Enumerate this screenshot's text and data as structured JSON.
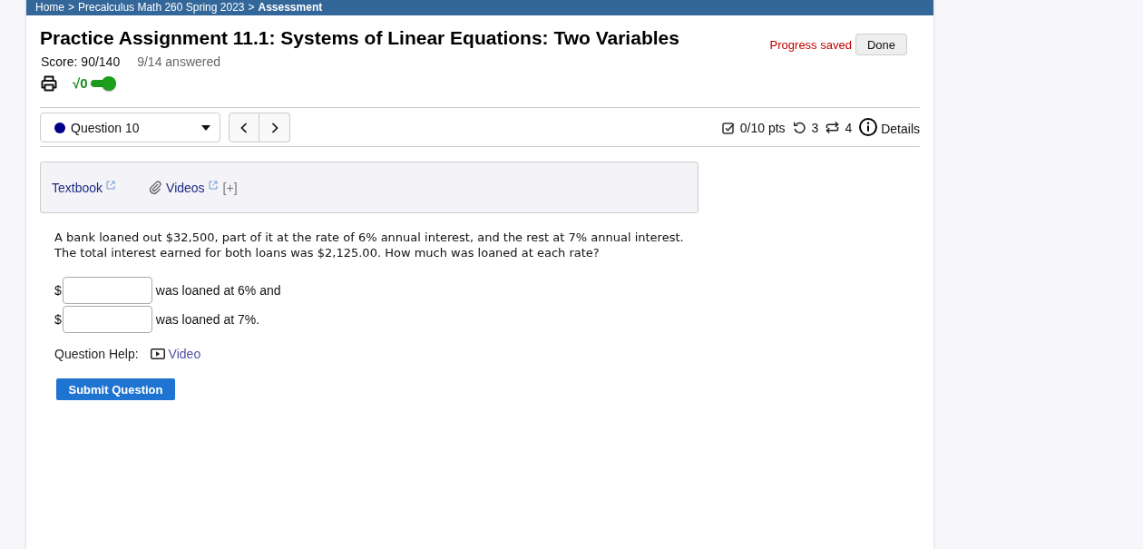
{
  "breadcrumb": [
    {
      "kind": "link",
      "label": "Home"
    },
    {
      "kind": "separator",
      "label": ">"
    },
    {
      "kind": "link",
      "label": "Precalculus Math 260 Spring 2023"
    },
    {
      "kind": "separator",
      "label": ">"
    },
    {
      "kind": "current",
      "label": "Assessment"
    }
  ],
  "header": {
    "title": "Practice Assignment 11.1: Systems of Linear Equations: Two Variables",
    "score": "Score: 90/140",
    "answered": "9/14 answered",
    "status": "Progress saved",
    "done_button": "Done",
    "math_toggle": {
      "label": "√0",
      "on": true
    }
  },
  "question_bar": {
    "selector": "Question 10",
    "points": "0/10 pts",
    "retries": "3",
    "attempts": "4",
    "details": "Details"
  },
  "help_box": {
    "links": [
      {
        "kind": "textbook",
        "label": "Textbook"
      },
      {
        "kind": "videos",
        "label": "Videos",
        "expander": "[+]"
      }
    ]
  },
  "question": {
    "text_lines": [
      "A bank loaned out $32,500, part of it at the rate of 6% annual interest, and the rest at 7% annual interest.",
      "The total interest earned for both loans was $2,125.00. How much was loaned at each rate?"
    ],
    "answers": [
      {
        "prefix": "$",
        "suffix": "was loaned at 6% and"
      },
      {
        "prefix": "$",
        "suffix": "was loaned at 7%."
      }
    ],
    "help_label": "Question Help:",
    "help_links": [
      {
        "kind": "video",
        "label": "Video"
      }
    ],
    "submit_button": "Submit Question"
  }
}
